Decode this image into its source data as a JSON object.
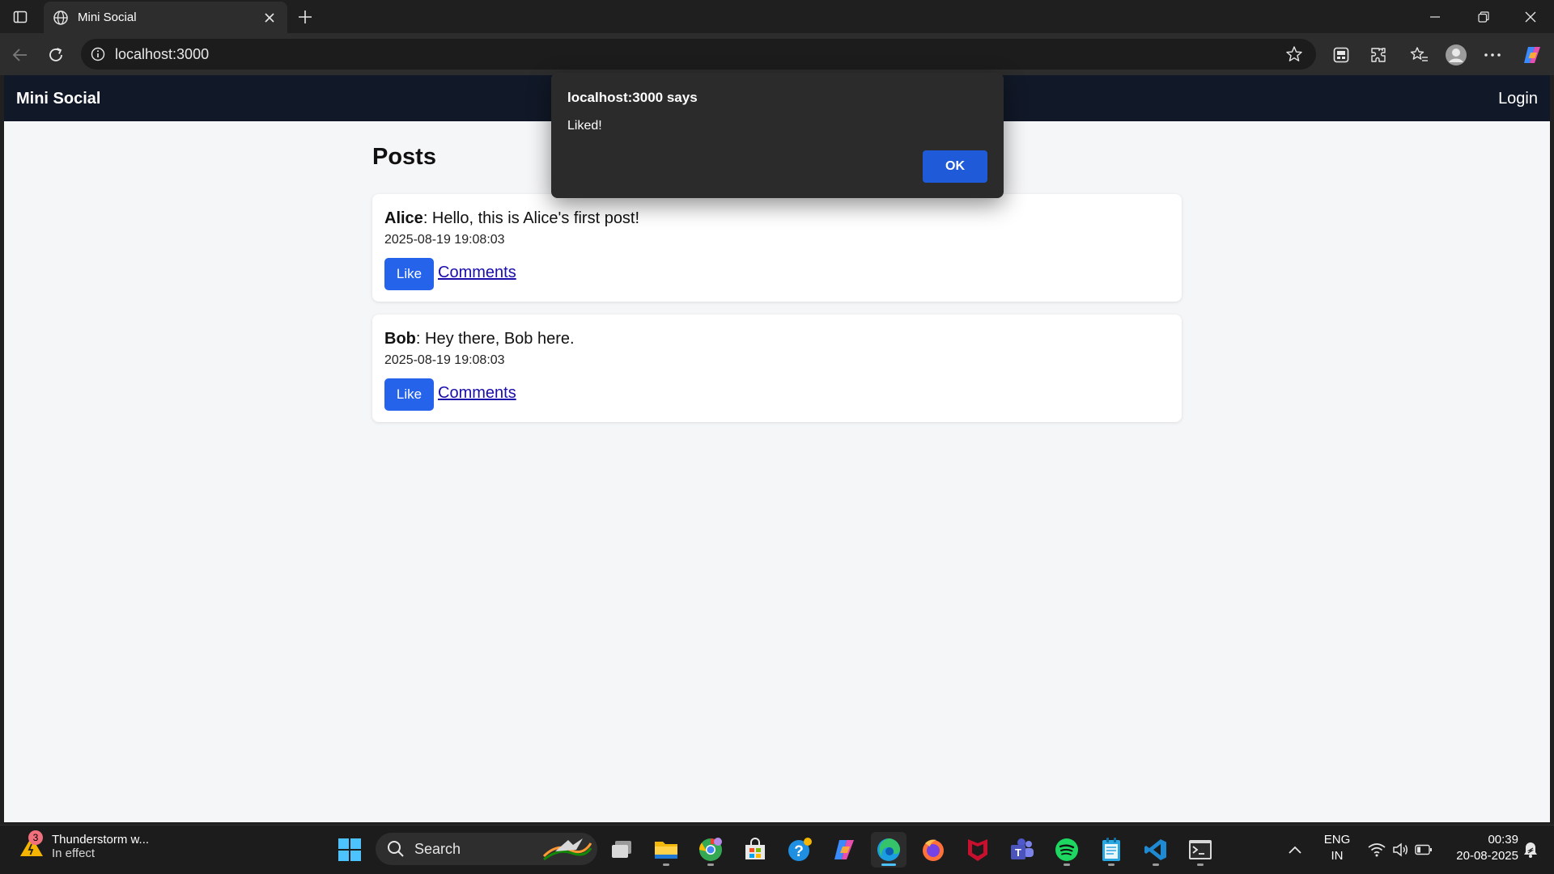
{
  "browser": {
    "tab_title": "Mini Social",
    "url": "localhost:3000"
  },
  "navbar": {
    "brand": "Mini Social",
    "login": "Login"
  },
  "page": {
    "heading": "Posts",
    "posts": [
      {
        "author": "Alice",
        "content": ": Hello, this is Alice's first post!",
        "timestamp": "2025-08-19 19:08:03",
        "like_label": "Like",
        "comments_label": "Comments"
      },
      {
        "author": "Bob",
        "content": ": Hey there, Bob here.",
        "timestamp": "2025-08-19 19:08:03",
        "like_label": "Like",
        "comments_label": "Comments"
      }
    ]
  },
  "dialog": {
    "title": "localhost:3000 says",
    "message": "Liked!",
    "ok_label": "OK"
  },
  "taskbar": {
    "weather": {
      "badge": "3",
      "title": "Thunderstorm w...",
      "subtitle": "In effect"
    },
    "search_label": "Search",
    "pinned_apps": [
      "start-icon",
      "task-view-icon",
      "file-explorer-icon",
      "chrome-icon",
      "microsoft-store-icon",
      "help-icon",
      "copilot-icon",
      "edge-icon",
      "firefox-icon",
      "mcafee-icon",
      "teams-icon",
      "spotify-icon",
      "notepad-icon",
      "vscode-icon",
      "terminal-icon"
    ],
    "language": {
      "line1": "ENG",
      "line2": "IN"
    },
    "clock": {
      "time": "00:39",
      "date": "20-08-2025"
    }
  },
  "colors": {
    "navbar_bg": "#111827",
    "like_button": "#2563eb",
    "dialog_bg": "#2b2b2b",
    "dialog_ok": "#1f5bd8",
    "link": "#1a0dab"
  }
}
